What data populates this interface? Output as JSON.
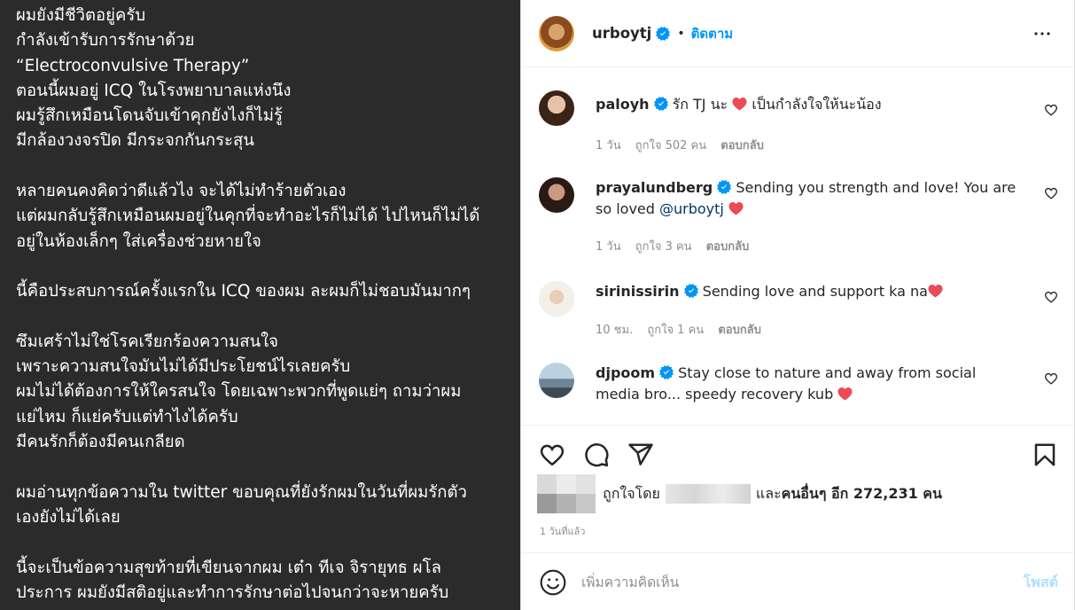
{
  "post_text": {
    "lines": [
      "ผมยังมีชีวิตอยู่ครับ",
      "กำลังเข้ารับการรักษาด้วย",
      "“Electroconvulsive Therapy”",
      "ตอนนี้ผมอยู่ ICQ ในโรงพยาบาลแห่งนึง",
      "ผมรู้สึกเหมือนโดนจับเข้าคุกยังไงก็ไม่รู้",
      "มีกล้องวงจรปิด มีกระจกกันกระสุน",
      "",
      "หลายคนคงคิดว่าดีแล้วไง จะได้ไม่ทำร้ายตัวเอง",
      "แต่ผมกลับรู้สึกเหมือนผมอยู่ในคุกที่จะทำอะไรก็ไม่ได้ ไปไหนก็ไม่ได้",
      "อยู่ในห้องเล็กๆ ใส่เครื่องช่วยหายใจ",
      "",
      "นี้คือประสบการณ์ครั้งแรกใน ICQ ของผม ละผมก็ไม่ชอบมันมากๆ",
      "",
      "ซึมเศร้าไม่ใช่โรคเรียกร้องความสนใจ",
      "เพราะความสนใจมันไม่ได้มีประโยชน์ไรเลยครับ",
      "ผมไม่ได้ต้องการให้ใครสนใจ โดยเฉพาะพวกที่พูดแย่ๆ ถามว่าผม",
      "แย่ไหม ก็แย่ครับแต่ทำไงได้ครับ",
      "มีคนรักก็ต้องมีคนเกลียด",
      "",
      "ผมอ่านทุกข้อความใน twitter ขอบคุณที่ยังรักผมในวันที่ผมรักตัว",
      "เองยังไม่ได้เลย",
      "",
      "นี้จะเป็นข้อความสุขท้ายที่เขียนจากผม เต๋า ทีเจ จิรายุทธ ผโล",
      "ประการ  ผมยังมีสติอยู่และทำการรักษาต่อไปจนกว่าจะหายครับ"
    ]
  },
  "header": {
    "username": "urboytj",
    "separator": "•",
    "follow_label": "ติดตาม"
  },
  "comments": [
    {
      "username": "paloyh",
      "text_before": "รัก TJ นะ",
      "text_after": "เป็นกำลังใจให้นะน้อง",
      "time": "1 วัน",
      "likes": "ถูกใจ 502 คน",
      "reply": "ตอบกลับ"
    },
    {
      "username": "prayalundberg",
      "text": "Sending you strength and love! You are so loved",
      "mention": "@urboytj",
      "time": "1 วัน",
      "likes": "ถูกใจ 3 คน",
      "reply": "ตอบกลับ"
    },
    {
      "username": "sirinissirin",
      "text": "Sending love and support ka na",
      "time": "10 ชม.",
      "likes": "ถูกใจ 1 คน",
      "reply": "ตอบกลับ"
    },
    {
      "username": "djpoom",
      "text": "Stay close to nature and away from social media bro... speedy recovery kub"
    }
  ],
  "likes": {
    "prefix": "ถูกใจโดย",
    "middle": "และ",
    "others": "คนอื่นๆ อีก 272,231 คน"
  },
  "time_ago": "1 วันที่แล้ว",
  "add_comment": {
    "placeholder": "เพิ่มความคิดเห็น",
    "post_label": "โพสต์"
  },
  "colors": {
    "accent": "#0095f6",
    "heart": "#ed4956",
    "post_bg": "#2b2b2b"
  }
}
